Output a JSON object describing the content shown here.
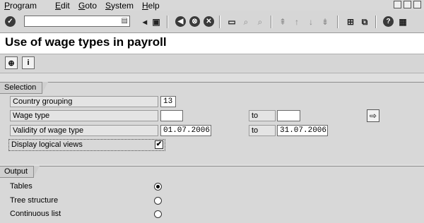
{
  "menubar": {
    "items": [
      "Program",
      "Edit",
      "Goto",
      "System",
      "Help"
    ]
  },
  "toolbar": {
    "command_field": {
      "value": "",
      "placeholder": ""
    },
    "icons": [
      "enter-icon",
      "save-icon",
      "back-icon",
      "exit-icon",
      "cancel-icon",
      "print-icon",
      "find-icon",
      "find-next-icon",
      "first-page-icon",
      "previous-page-icon",
      "next-page-icon",
      "last-page-icon",
      "create-session-icon",
      "shortcut-icon",
      "help-icon",
      "layout-menu-icon"
    ]
  },
  "title": "Use of wage types in payroll",
  "app_toolbar": {
    "icons": [
      "execute-icon",
      "information-icon"
    ]
  },
  "selection": {
    "header": "Selection",
    "country_grouping": {
      "label": "Country grouping",
      "value": "13"
    },
    "wage_type": {
      "label": "Wage type",
      "from": "",
      "to_label": "to",
      "to": ""
    },
    "validity": {
      "label": "Validity of wage type",
      "from": "01.07.2006",
      "to_label": "to",
      "to": "31.07.2006"
    },
    "display_logical_views": {
      "label": "Display logical views",
      "checked": true,
      "mark": "✔"
    }
  },
  "output": {
    "header": "Output",
    "options": [
      {
        "label": "Tables",
        "selected": true
      },
      {
        "label": "Tree structure",
        "selected": false
      },
      {
        "label": "Continuous list",
        "selected": false
      }
    ]
  }
}
